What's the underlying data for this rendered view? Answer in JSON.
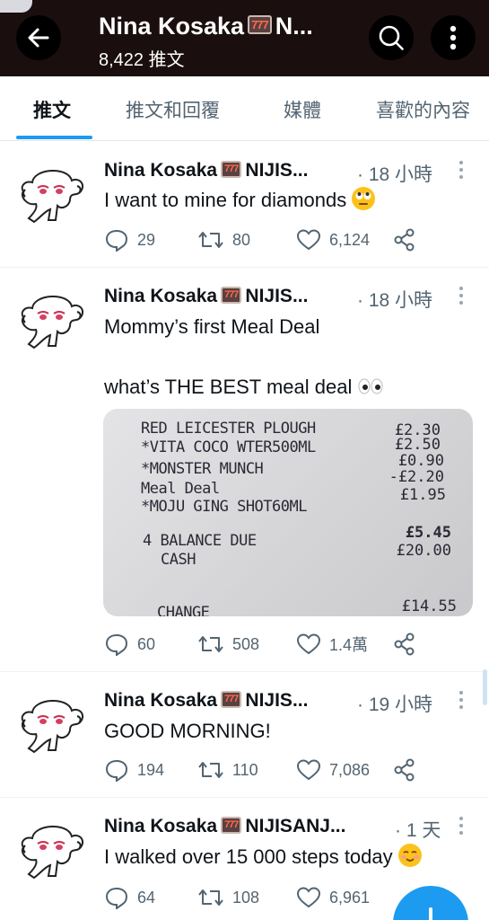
{
  "header": {
    "title": "Nina Kosaka",
    "title_emoji": "777",
    "title_suffix": "N...",
    "subtitle": "8,422 推文"
  },
  "tabs": [
    {
      "label": "推文",
      "active": true
    },
    {
      "label": "推文和回覆",
      "active": false
    },
    {
      "label": "媒體",
      "active": false
    },
    {
      "label": "喜歡的內容",
      "active": false
    }
  ],
  "tweets": [
    {
      "name": "Nina Kosaka",
      "emoji": "777",
      "handle": "NIJIS...",
      "time": "· 18 小時",
      "text": "I want to mine for diamonds",
      "emoji_icon": "face-rolling-eyes-icon",
      "replies": "29",
      "retweets": "80",
      "likes": "6,124"
    },
    {
      "name": "Nina Kosaka",
      "emoji": "777",
      "handle": "NIJIS...",
      "time": "· 18 小時",
      "text": "Mommy’s first Meal Deal",
      "text2": "what’s THE BEST meal deal",
      "emoji_icon": "eyes-icon",
      "replies": "60",
      "retweets": "508",
      "likes": "1.4萬",
      "receipt": {
        "lines": [
          "RED LEICESTER PLOUGH",
          "*VITA COCO WTER500ML",
          "*MONSTER MUNCH",
          "Meal Deal",
          "*MOJU GING SHOT60ML"
        ],
        "prices": [
          "£2.30",
          "£2.50",
          "£0.90",
          "-£2.20",
          "£1.95"
        ],
        "balance_label": "4 BALANCE DUE",
        "cash_label": "CASH",
        "balance": "£5.45",
        "cash": "£20.00",
        "change_label": "CHANGE",
        "change": "£14.55"
      }
    },
    {
      "name": "Nina Kosaka",
      "emoji": "777",
      "handle": "NIJIS...",
      "time": "· 19 小時",
      "text": "GOOD MORNING!",
      "replies": "194",
      "retweets": "110",
      "likes": "7,086"
    },
    {
      "name": "Nina Kosaka",
      "emoji": "777",
      "handle": "NIJISANJ...",
      "time": "· 1 天",
      "text": "I walked over 15 000 steps today",
      "emoji_icon": "smiling-face-icon",
      "replies": "64",
      "retweets": "108",
      "likes": "6,961"
    }
  ],
  "colors": {
    "accent": "#1d9bf0",
    "header_bg": "#1a0e0e",
    "muted": "#536471"
  }
}
